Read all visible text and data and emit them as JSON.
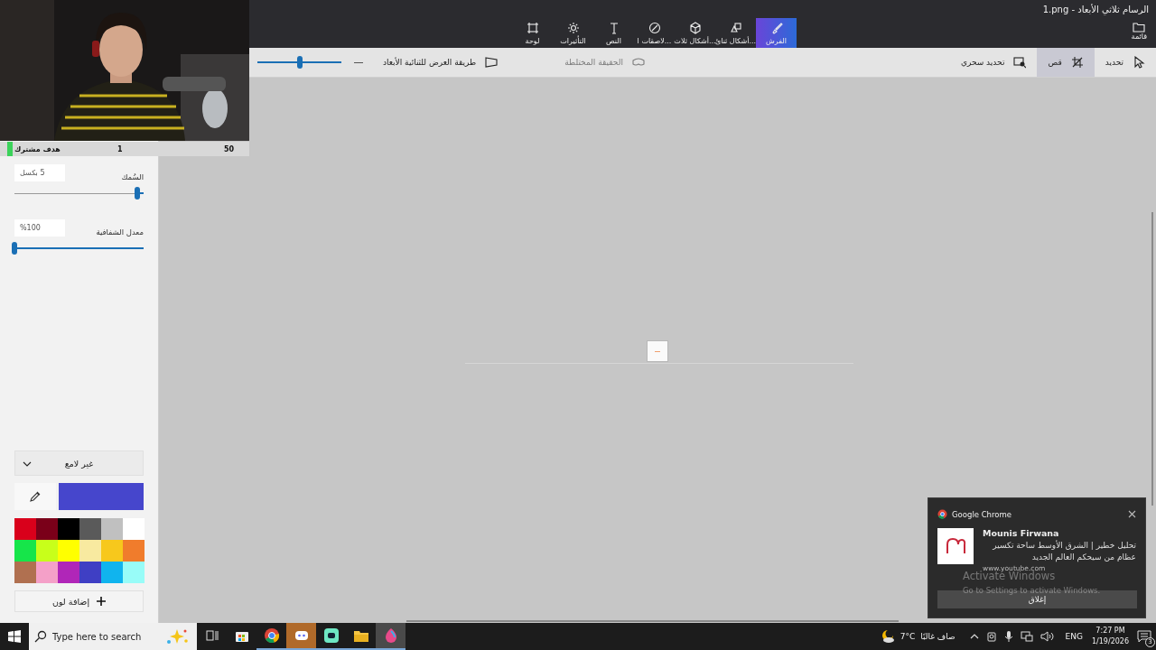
{
  "window": {
    "title": "1.png - الرسام ثلاثي الأبعاد",
    "menu_button": "قائمة"
  },
  "tabs": [
    {
      "label": "الفرش",
      "selected": true
    },
    {
      "label": "أشكال ثنائ...",
      "selected": false
    },
    {
      "label": "أشكال ثلاث...",
      "selected": false
    },
    {
      "label": "لاصقات ا...",
      "selected": false
    },
    {
      "label": "النص",
      "selected": false
    },
    {
      "label": "التأثيرات",
      "selected": false
    },
    {
      "label": "لوحة",
      "selected": false
    }
  ],
  "toolbar": {
    "tools": [
      {
        "label": "تحديد",
        "selected": false
      },
      {
        "label": "قص",
        "selected": true
      },
      {
        "label": "تحديد سحري",
        "selected": false
      }
    ],
    "mixed_reality": {
      "label": "الحقيقة المختلطة",
      "disabled": true
    },
    "view_mode": {
      "label": "طريقة العرض للثنائية الأبعاد"
    },
    "zoom": {
      "level": 0.5
    }
  },
  "stream_overlay": {
    "goal_label": "هدف مشترك",
    "goal_count": "1",
    "goal_target": "50",
    "level": 0.02
  },
  "side_panel": {
    "thickness": {
      "label": "السُمك",
      "value": "5 بكسل",
      "level": 0.05
    },
    "opacity": {
      "label": "معدل الشفافية",
      "value": "%100",
      "level": 1.0
    },
    "finish": "غير لامع",
    "current_color": {
      "color": "#4646cc"
    },
    "palette": [
      {
        "color": "#d9001b"
      },
      {
        "color": "#7a0019"
      },
      {
        "color": "#000000"
      },
      {
        "color": "#5a5a5a"
      },
      {
        "color": "#c0c0c0"
      },
      {
        "color": "#ffffff"
      },
      {
        "color": "#16e54a"
      },
      {
        "color": "#c8ff1a"
      },
      {
        "color": "#ffff00"
      },
      {
        "color": "#f8eaa0"
      },
      {
        "color": "#f7c81c"
      },
      {
        "color": "#f07c2c"
      },
      {
        "color": "#b07050"
      },
      {
        "color": "#f4a0c8"
      },
      {
        "color": "#b026b8"
      },
      {
        "color": "#3f3fc4"
      },
      {
        "color": "#10b4ee"
      },
      {
        "color": "#98fcf8"
      }
    ],
    "add_color": "إضافة لون"
  },
  "notification": {
    "app": "Google Chrome",
    "title": "Mounis Firwana",
    "body": "تحليل خطير | الشرق الأوسط ساحة تكسير عظام من سيحكم العالم الجديد",
    "source": "www.youtube.com",
    "button": "إغلاق"
  },
  "activation": {
    "title": "Activate Windows",
    "subtitle": "Go to Settings to activate Windows."
  },
  "taskbar": {
    "search_placeholder": "Type here to search",
    "apps": [
      {
        "running": false,
        "flashing": false,
        "selected": false
      },
      {
        "running": false,
        "flashing": false,
        "selected": false
      },
      {
        "running": true,
        "flashing": false,
        "selected": false
      },
      {
        "running": true,
        "flashing": true,
        "selected": false
      },
      {
        "running": true,
        "flashing": false,
        "selected": false
      },
      {
        "running": true,
        "flashing": false,
        "selected": false
      },
      {
        "running": true,
        "flashing": false,
        "selected": true
      }
    ],
    "temperature": "7°C",
    "weather": "صاف غالبًا",
    "language": "ENG",
    "time": "7:27 PM",
    "date": "1/19/2026",
    "notification_count": "3"
  }
}
